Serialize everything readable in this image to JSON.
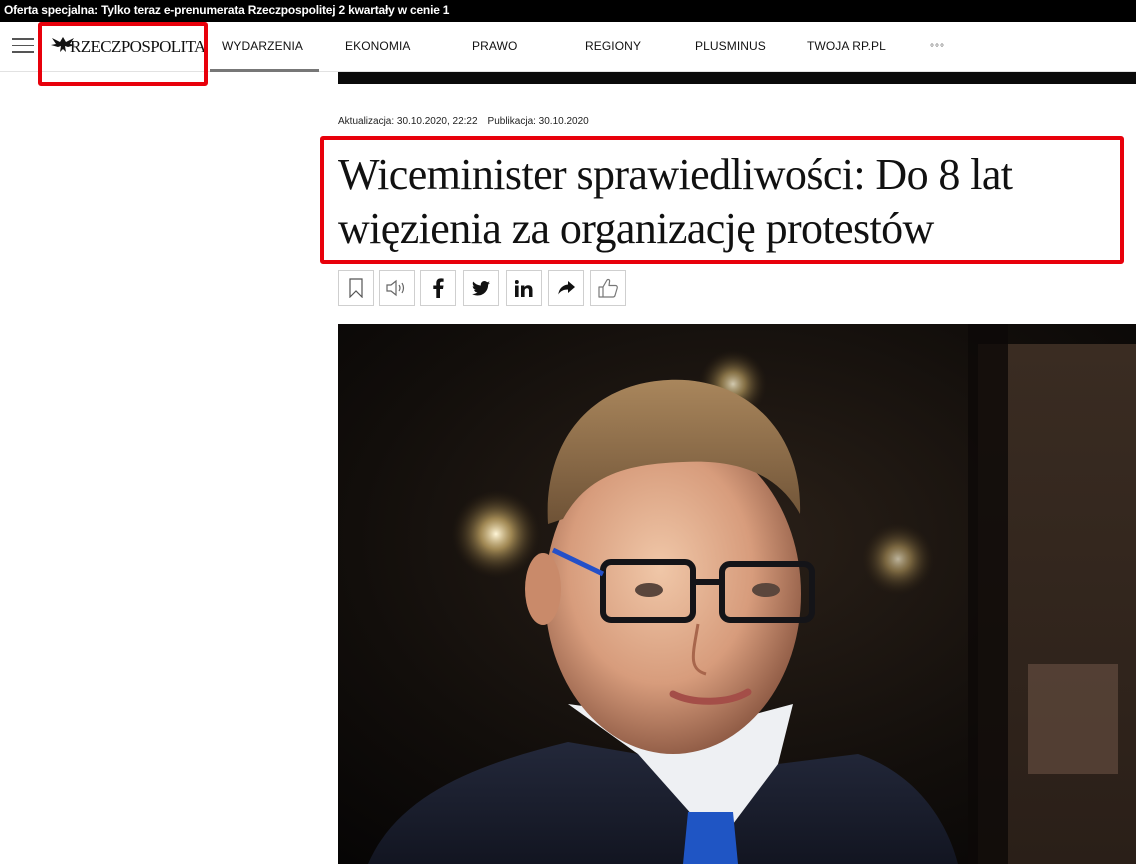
{
  "promo": {
    "text": "Oferta specjalna: Tylko teraz e-prenumerata Rzeczpospolitej 2 kwartały w cenie 1"
  },
  "header": {
    "logo_text": "RZECZPOSPOLITA",
    "nav": [
      {
        "label": "WYDARZENIA",
        "active": true
      },
      {
        "label": "EKONOMIA"
      },
      {
        "label": "PRAWO"
      },
      {
        "label": "REGIONY"
      },
      {
        "label": "PLUSMINUS"
      },
      {
        "label": "TWOJA RP.PL"
      }
    ],
    "more_label": "°°°"
  },
  "article": {
    "updated": "Aktualizacja: 30.10.2020, 22:22",
    "published": "Publikacja: 30.10.2020",
    "title_line1": "Wiceminister sprawiedliwości: Do 8 lat",
    "title_line2": "więzienia za organizację protestów"
  },
  "share_buttons": [
    "bookmark-icon",
    "speaker-icon",
    "facebook-icon",
    "twitter-icon",
    "linkedin-icon",
    "share-arrow-icon",
    "thumbs-up-icon"
  ],
  "colors": {
    "highlight": "#e8000b",
    "promo_bg": "#000000",
    "nav_active_underline": "#777777"
  }
}
